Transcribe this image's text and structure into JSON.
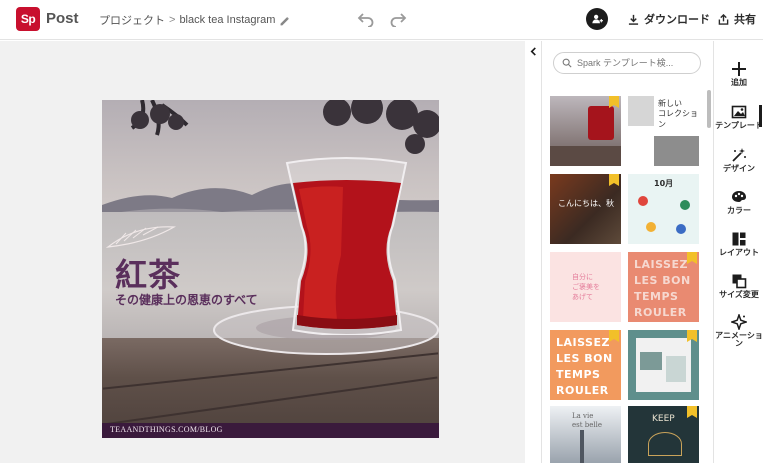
{
  "app": {
    "logo_text": "Sp",
    "name": "Post"
  },
  "breadcrumb": {
    "project": "プロジェクト",
    "separator": ">",
    "document": "black tea Instagram"
  },
  "toolbar": {
    "download_label": "ダウンロード",
    "share_label": "共有"
  },
  "artboard": {
    "title": "紅茶",
    "subtitle": "その健康上の恩恵のすべて",
    "url": "TEAANDTHINGS.COM/BLOG",
    "colors": {
      "text": "#5a2f5c",
      "url_bar": "#3a1a3c",
      "tea": "#b3121b"
    }
  },
  "panel": {
    "search_placeholder": "Spark テンプレート検...",
    "templates": [
      {
        "id": "t1",
        "premium": true,
        "texts": []
      },
      {
        "id": "t2",
        "premium": false,
        "texts": [
          "新しい",
          "コレクション"
        ]
      },
      {
        "id": "t3",
        "premium": true,
        "texts": [
          "こんにちは、秋"
        ]
      },
      {
        "id": "t4",
        "premium": false,
        "texts": [
          "10月"
        ]
      },
      {
        "id": "t5",
        "premium": false,
        "texts": [
          "自分に",
          "ご褒美を",
          "あげて"
        ]
      },
      {
        "id": "t6",
        "premium": true,
        "texts": [
          "LAISSEZ",
          "LES BON",
          "TEMPS",
          "ROULER"
        ]
      },
      {
        "id": "t7",
        "premium": true,
        "texts": [
          "LAISSEZ",
          "LES BON",
          "TEMPS",
          "ROULER"
        ]
      },
      {
        "id": "t8",
        "premium": true,
        "texts": []
      },
      {
        "id": "t9",
        "premium": false,
        "texts": [
          "La vie",
          "est belle"
        ]
      },
      {
        "id": "t10",
        "premium": true,
        "texts": [
          "KEEP"
        ]
      }
    ]
  },
  "rail": {
    "items": [
      {
        "icon": "plus-icon",
        "label": "追加"
      },
      {
        "icon": "template-icon",
        "label": "テンプレート"
      },
      {
        "icon": "magic-wand-icon",
        "label": "デザイン"
      },
      {
        "icon": "palette-icon",
        "label": "カラー"
      },
      {
        "icon": "layout-icon",
        "label": "レイアウト"
      },
      {
        "icon": "resize-icon",
        "label": "サイズ変更"
      },
      {
        "icon": "animation-icon",
        "label": "アニメーション"
      }
    ],
    "active": "テンプレート"
  }
}
